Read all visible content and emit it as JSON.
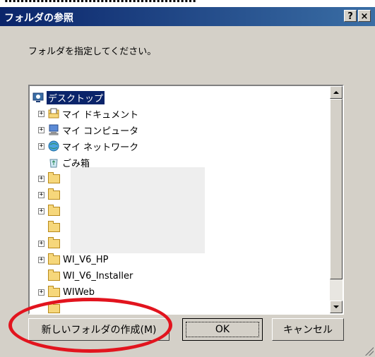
{
  "title": "フォルダの参照",
  "title_buttons": {
    "help": "?",
    "close": "×"
  },
  "instruction": "フォルダを指定してください。",
  "tree": {
    "items": [
      {
        "label": "デスクトップ",
        "icon": "desktop-icon"
      },
      {
        "label": "マイ ドキュメント",
        "icon": "documents-icon"
      },
      {
        "label": "マイ コンピュータ",
        "icon": "computer-icon"
      },
      {
        "label": "マイ ネットワーク",
        "icon": "network-icon"
      },
      {
        "label": "ごみ箱",
        "icon": "recycle-bin-icon"
      },
      {
        "label": "WI_V6_HP",
        "icon": "folder-icon"
      },
      {
        "label": "WI_V6_Installer",
        "icon": "folder-icon"
      },
      {
        "label": "WIWeb",
        "icon": "folder-icon"
      }
    ]
  },
  "buttons": {
    "new_folder": "新しいフォルダの作成(M)",
    "ok": "OK",
    "cancel": "キャンセル"
  },
  "colors": {
    "titlebar": "#0a246a",
    "annotation": "#e2141e",
    "selection": "#0a246a"
  }
}
